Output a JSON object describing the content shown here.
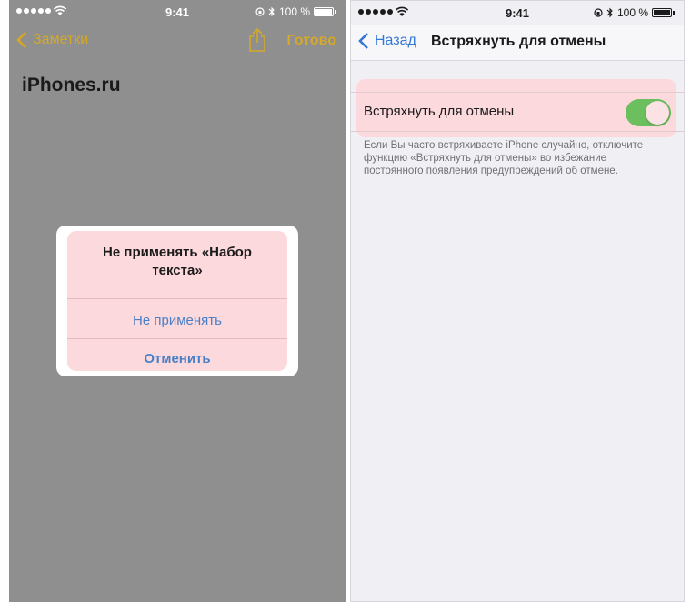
{
  "left_screen": {
    "status": {
      "time": "9:41",
      "battery": "100 %"
    },
    "nav": {
      "back_label": "Заметки",
      "done_label": "Готово"
    },
    "note_title": "iPhones.ru",
    "alert": {
      "title": "Не применять «Набор текста»",
      "primary_button": "Не применять",
      "cancel_button": "Отменить"
    }
  },
  "right_screen": {
    "status": {
      "time": "9:41",
      "battery": "100 %"
    },
    "nav": {
      "back_label": "Назад",
      "title": "Встряхнуть для отмены"
    },
    "setting": {
      "label": "Встряхнуть для отмены",
      "enabled": true
    },
    "footer": "Если Вы часто встряхиваете iPhone случайно, отключите функцию «Встряхнуть для отмены» во избежание постоянного появления предупреждений об отмене."
  },
  "colors": {
    "notes_accent": "#d4a82a",
    "settings_accent": "#3478d6",
    "toggle_on": "#6cbf5e",
    "highlight": "#fcd9dd"
  }
}
